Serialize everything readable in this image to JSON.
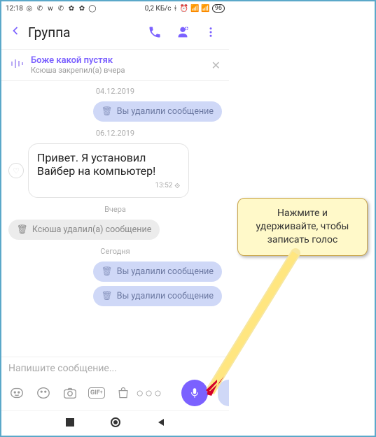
{
  "status": {
    "time": "12:18",
    "data_rate": "0,2 КБ/с",
    "battery": "96"
  },
  "header": {
    "title": "Группа"
  },
  "pinned": {
    "title": "Боже какой пустяк",
    "subtitle": "Ксюша закрепил(а) вчера"
  },
  "dates": {
    "d1": "04.12.2019",
    "d2": "06.12.2019",
    "d3": "Вчера",
    "d4": "Сегодня"
  },
  "messages": {
    "deleted_self": "Вы удалили сообщение",
    "hi": "Привет. Я установил Вайбер на компьютер!",
    "hi_time": "13:52",
    "deleted_other": "Ксюша удалил(а) сообщение"
  },
  "input": {
    "placeholder": "Напишите сообщение...",
    "gif_label": "GIF"
  },
  "callout": {
    "text": "Нажмите и удерживайте, чтобы записать голос"
  }
}
